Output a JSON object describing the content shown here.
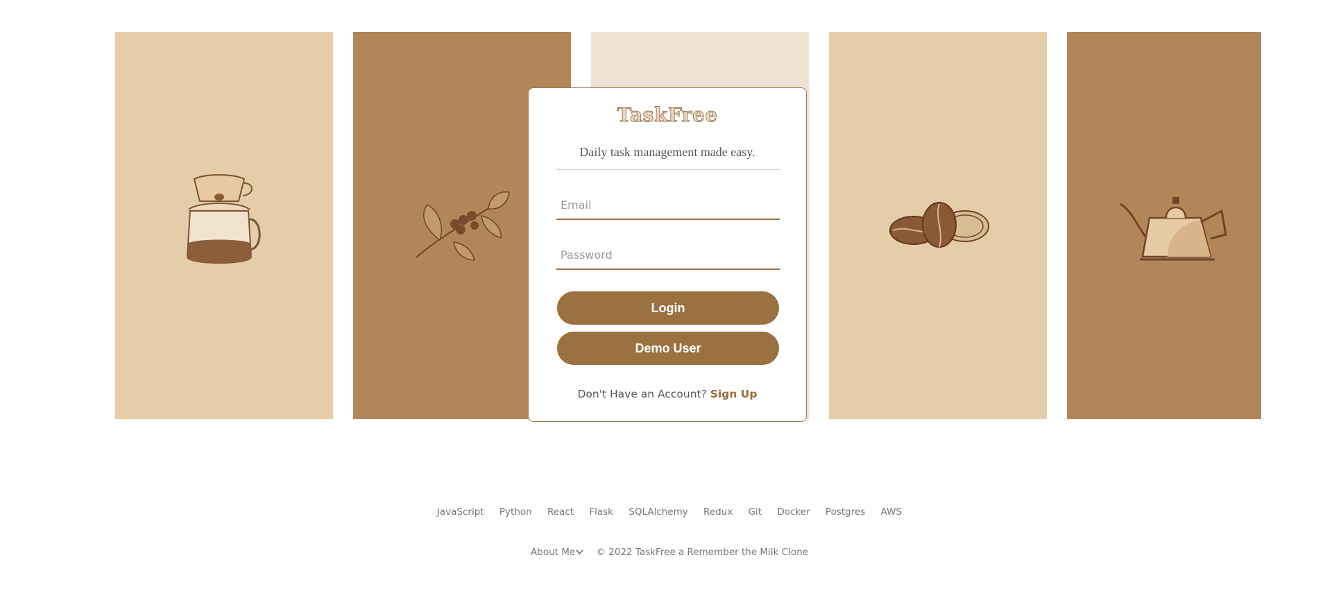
{
  "app": {
    "name": "TaskFree",
    "tagline": "Daily task management made easy."
  },
  "panels": [
    {
      "icon": "pour-over-coffee-maker-icon",
      "color": "#e4cda8"
    },
    {
      "icon": "coffee-branch-icon",
      "color": "#b3865a"
    },
    {
      "icon": "none",
      "color": "#eee3d3"
    },
    {
      "icon": "coffee-beans-icon",
      "color": "#e4cda8"
    },
    {
      "icon": "gooseneck-kettle-icon",
      "color": "#b3865a"
    }
  ],
  "login": {
    "email_placeholder": "Email",
    "email_value": "",
    "password_placeholder": "Password",
    "password_value": "",
    "login_label": "Login",
    "demo_label": "Demo User",
    "signup_prompt": "Don't Have an Account?",
    "signup_link": "Sign Up"
  },
  "tech": [
    "JavaScript",
    "Python",
    "React",
    "Flask",
    "SQLAlchemy",
    "Redux",
    "Git",
    "Docker",
    "Postgres",
    "AWS"
  ],
  "footer": {
    "about_label": "About Me",
    "copyright": "© 2022 TaskFree a Remember the Milk Clone"
  },
  "colors": {
    "brand": "#9c7142",
    "panel_light": "#e4cda8",
    "panel_dark": "#b3865a",
    "panel_pale": "#eee3d3"
  }
}
